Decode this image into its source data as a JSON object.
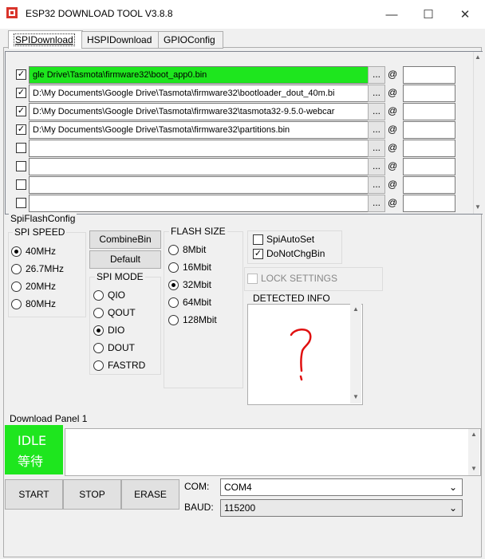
{
  "window": {
    "title": "ESP32 DOWNLOAD TOOL V3.8.8",
    "minimize_glyph": "—",
    "maximize_glyph": "☐",
    "close_glyph": "✕"
  },
  "tabs": [
    {
      "label": "SPIDownload",
      "active": true
    },
    {
      "label": "HSPIDownload",
      "active": false
    },
    {
      "label": "GPIOConfig",
      "active": false
    }
  ],
  "files": [
    {
      "checked": true,
      "path": "gle Drive\\Tasmota\\firmware32\\boot_app0.bin",
      "highlight": true,
      "address": ""
    },
    {
      "checked": true,
      "path": "D:\\My Documents\\Google Drive\\Tasmota\\firmware32\\bootloader_dout_40m.bi",
      "highlight": false,
      "address": ""
    },
    {
      "checked": true,
      "path": "D:\\My Documents\\Google Drive\\Tasmota\\firmware32\\tasmota32-9.5.0-webcar",
      "highlight": false,
      "address": ""
    },
    {
      "checked": true,
      "path": "D:\\My Documents\\Google Drive\\Tasmota\\firmware32\\partitions.bin",
      "highlight": false,
      "address": ""
    },
    {
      "checked": false,
      "path": "",
      "highlight": false,
      "address": ""
    },
    {
      "checked": false,
      "path": "",
      "highlight": false,
      "address": ""
    },
    {
      "checked": false,
      "path": "",
      "highlight": false,
      "address": ""
    },
    {
      "checked": false,
      "path": "",
      "highlight": false,
      "address": ""
    }
  ],
  "file_row": {
    "browse_label": "...",
    "at_label": "@",
    "check_glyph": "✓"
  },
  "spi_flash_config": {
    "label": "SpiFlashConfig",
    "spi_speed": {
      "label": "SPI SPEED",
      "options": [
        "40MHz",
        "26.7MHz",
        "20MHz",
        "80MHz"
      ],
      "selected": "40MHz"
    },
    "combine_bin_label": "CombineBin",
    "default_label": "Default",
    "spi_mode": {
      "label": "SPI MODE",
      "options": [
        "QIO",
        "QOUT",
        "DIO",
        "DOUT",
        "FASTRD"
      ],
      "selected": "DIO"
    },
    "flash_size": {
      "label": "FLASH SIZE",
      "options": [
        "8Mbit",
        "16Mbit",
        "32Mbit",
        "64Mbit",
        "128Mbit"
      ],
      "selected": "32Mbit"
    },
    "spi_auto_set": {
      "label": "SpiAutoSet",
      "checked": false
    },
    "do_not_chg_bin": {
      "label": "DoNotChgBin",
      "checked": true
    },
    "lock_settings": {
      "label": "LOCK SETTINGS",
      "checked": false
    },
    "detected_info": {
      "label": "DETECTED INFO",
      "scroll_up": "▲",
      "scroll_down": "▼"
    }
  },
  "download_panel": {
    "label": "Download Panel 1",
    "status_en": "IDLE",
    "status_cn": "等待",
    "status_color": "#1ee61e",
    "log_scroll_up": "▲",
    "log_scroll_down": "▼"
  },
  "controls": {
    "start_label": "START",
    "stop_label": "STOP",
    "erase_label": "ERASE",
    "com_label": "COM:",
    "com_value": "COM4",
    "baud_label": "BAUD:",
    "baud_value": "115200",
    "dropdown_glyph": "⌄"
  },
  "list_scroll": {
    "up": "▲",
    "down": "▼"
  }
}
